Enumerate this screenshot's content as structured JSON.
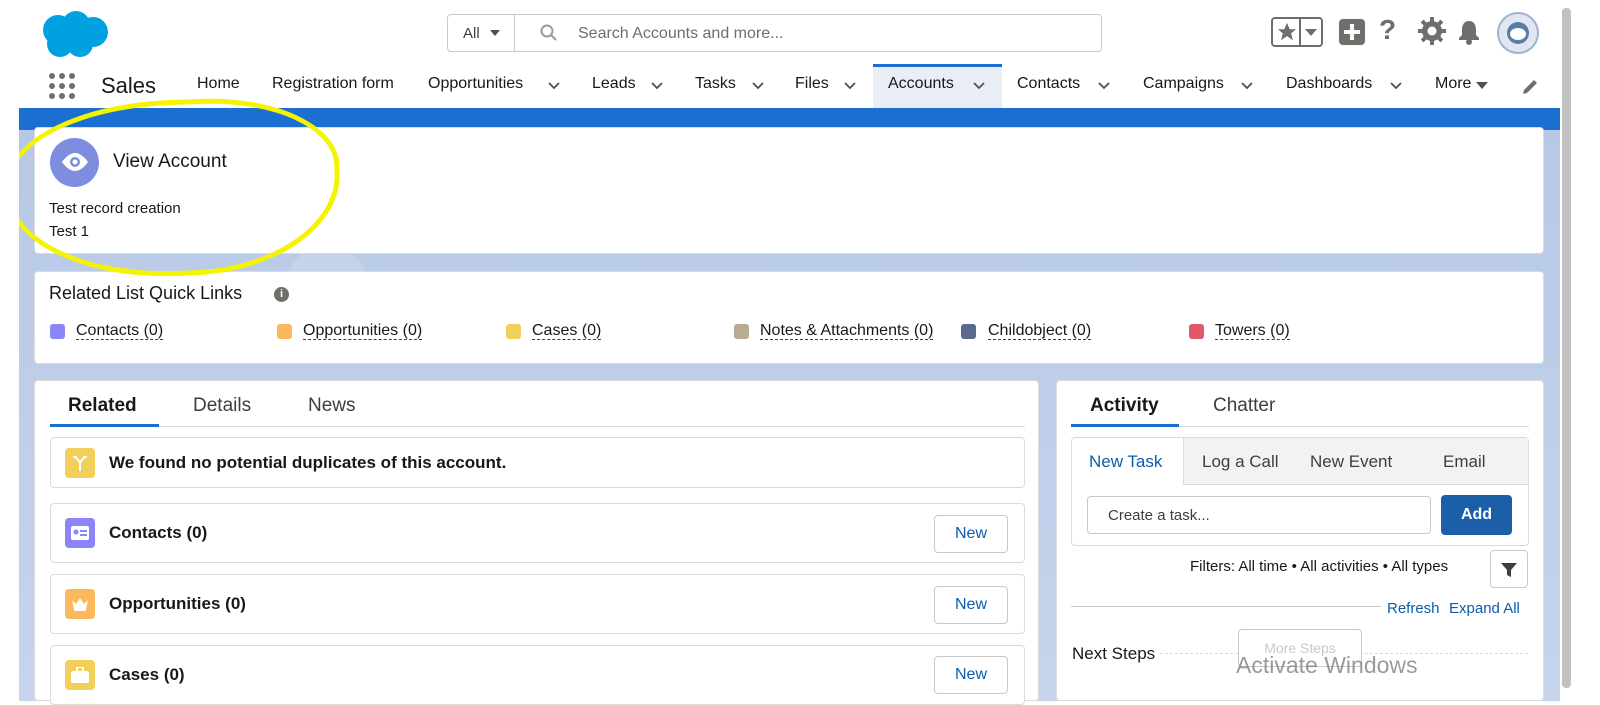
{
  "header": {
    "search_scope": "All",
    "search_placeholder": "Search Accounts and more..."
  },
  "nav": {
    "app_name": "Sales",
    "items": [
      {
        "label": "Home"
      },
      {
        "label": "Registration form"
      },
      {
        "label": "Opportunities"
      },
      {
        "label": "Leads"
      },
      {
        "label": "Tasks"
      },
      {
        "label": "Files"
      },
      {
        "label": "Accounts"
      },
      {
        "label": "Contacts"
      },
      {
        "label": "Campaigns"
      },
      {
        "label": "Dashboards"
      },
      {
        "label": "More"
      }
    ],
    "active": "Accounts"
  },
  "record_header": {
    "title": "View Account",
    "line1": "Test record creation",
    "line2": "Test 1"
  },
  "quick_links": {
    "title": "Related List Quick Links",
    "items": [
      {
        "label": "Contacts (0)",
        "color": "#8b85f9"
      },
      {
        "label": "Opportunities (0)",
        "color": "#fcb95b"
      },
      {
        "label": "Cases (0)",
        "color": "#f2cf5b"
      },
      {
        "label": "Notes & Attachments (0)",
        "color": "#baac93"
      },
      {
        "label": "Childobject (0)",
        "color": "#5a6a8e"
      },
      {
        "label": "Towers (0)",
        "color": "#e3566b"
      }
    ]
  },
  "related_tabs": {
    "tabs": [
      "Related",
      "Details",
      "News"
    ],
    "active": "Related"
  },
  "related": {
    "duplicates_message": "We found no potential duplicates of this account.",
    "lists": [
      {
        "title": "Contacts (0)",
        "button": "New",
        "color": "#8b85f9"
      },
      {
        "title": "Opportunities (0)",
        "button": "New",
        "color": "#fcb95b"
      },
      {
        "title": "Cases (0)",
        "button": "New",
        "color": "#f2cf5b"
      }
    ]
  },
  "activity": {
    "tabs": [
      "Activity",
      "Chatter"
    ],
    "active": "Activity",
    "publisher_tabs": [
      "New Task",
      "Log a Call",
      "New Event",
      "Email"
    ],
    "publisher_active": "New Task",
    "task_placeholder": "Create a task...",
    "add_label": "Add",
    "filters": "Filters: All time • All activities • All types",
    "refresh": "Refresh",
    "expand_all": "Expand All",
    "next_steps": "Next Steps",
    "more_steps": "More Steps"
  },
  "watermark": "Activate Windows",
  "colors": {
    "brand_blue": "#1b6fd1",
    "link_blue": "#0b5cab",
    "highlight_yellow": "#f4f300"
  }
}
